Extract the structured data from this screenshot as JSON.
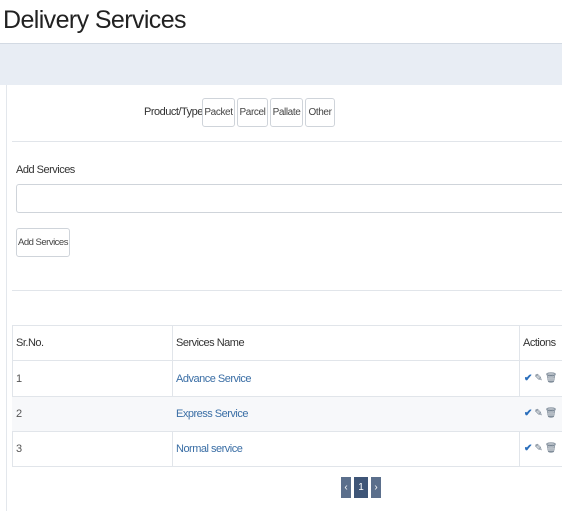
{
  "page": {
    "title": "Delivery Services"
  },
  "product_type": {
    "label": "Product/Type",
    "options": [
      {
        "label": "Packet"
      },
      {
        "label": "Parcel"
      },
      {
        "label": "Pallate"
      },
      {
        "label": "Other"
      }
    ]
  },
  "add_services": {
    "label": "Add Services",
    "input_value": "",
    "button_label": "Add Services"
  },
  "table": {
    "headers": {
      "sr_no": "Sr.No.",
      "service_name": "Services Name",
      "actions": "Actions"
    },
    "rows": [
      {
        "sr": "1",
        "name": "Advance Service"
      },
      {
        "sr": "2",
        "name": "Express Service"
      },
      {
        "sr": "3",
        "name": "Normal service"
      }
    ],
    "action_icons": [
      "check-icon",
      "edit-icon",
      "trash-icon"
    ]
  },
  "pagination": {
    "prev": "‹",
    "current": "1",
    "next": "›"
  },
  "colors": {
    "link": "#3a6ea5",
    "pager": "#3e5577",
    "band": "#e8edf4"
  }
}
